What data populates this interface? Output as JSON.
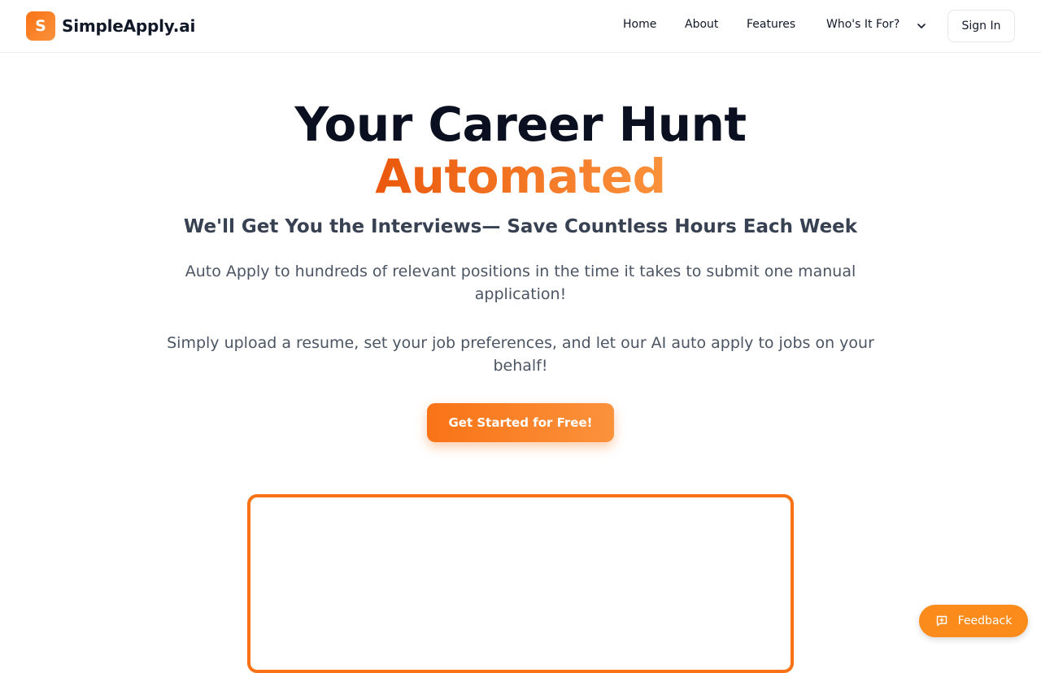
{
  "brand": {
    "logo_letter": "S",
    "name": "SimpleApply.ai"
  },
  "nav": {
    "items": [
      {
        "label": "Home"
      },
      {
        "label": "About"
      },
      {
        "label": "Features"
      },
      {
        "label": "Who's It For?"
      }
    ],
    "dropdown_icon": "chevron-down-icon",
    "sign_in_label": "Sign In"
  },
  "hero": {
    "title": "Your Career Hunt",
    "title_accent": "Automated",
    "subtitle": "We'll Get You the Interviews— Save Countless Hours Each Week",
    "paragraph_1": "Auto Apply to hundreds of relevant positions in the time it takes to submit one manual application!",
    "paragraph_2": "Simply upload a resume, set your job preferences, and let our AI auto apply to jobs on your behalf!",
    "cta_label": "Get Started for Free!"
  },
  "feedback": {
    "label": "Feedback",
    "icon": "message-plus-icon"
  },
  "colors": {
    "accent": "#f97316",
    "accent_light": "#fb923c",
    "text_dark": "#0b1020"
  }
}
